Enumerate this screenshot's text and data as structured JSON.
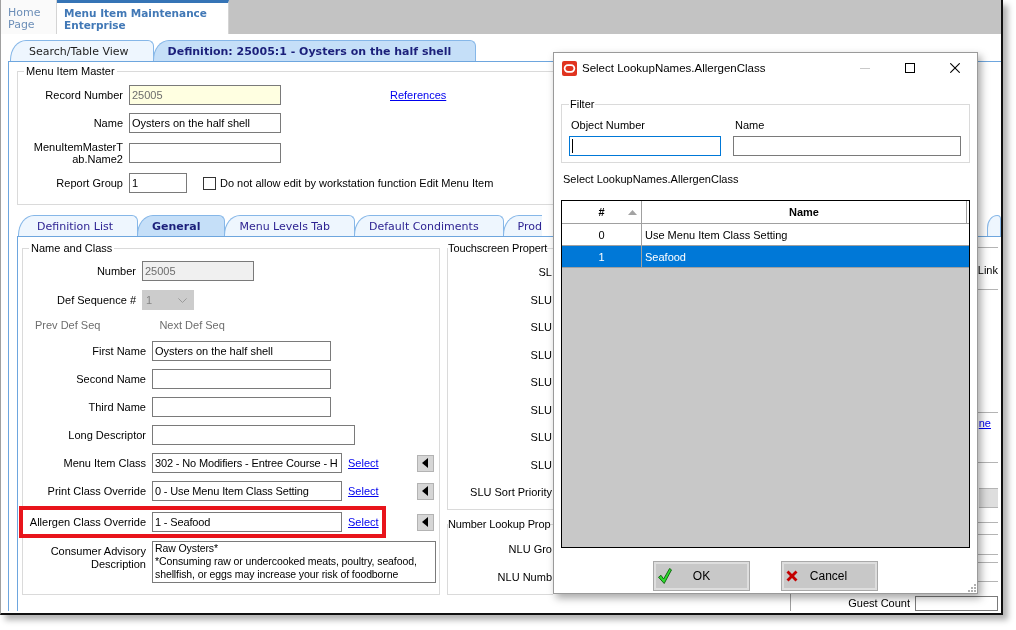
{
  "app_tabs": [
    {
      "label": "Home Page",
      "selected": false
    },
    {
      "label": "Menu Item Maintenance Enterprise",
      "selected": true
    }
  ],
  "record_tabs": [
    {
      "label": "Search/Table View",
      "selected": false
    },
    {
      "label": "Definition: 25005:1 - Oysters on the half shell",
      "selected": true
    }
  ],
  "menu_item_master": {
    "title": "Menu Item Master",
    "fields": [
      {
        "kind": "key",
        "label": "Record Number",
        "value": "25005",
        "link": "References"
      },
      {
        "kind": "text",
        "label": "Name",
        "value": "Oysters on the half shell"
      },
      {
        "kind": "text",
        "label": "MenuItemMasterTab.Name2"
      },
      {
        "kind": "short",
        "label": "Report Group",
        "value": "1",
        "checkbox": {
          "label": "Do not allow edit by workstation function Edit Menu Item",
          "checked": false
        }
      }
    ]
  },
  "detail_tabs": [
    {
      "label": "Definition List",
      "selected": false
    },
    {
      "label": "General",
      "selected": true
    },
    {
      "label": "Menu Levels Tab",
      "selected": false
    },
    {
      "label": "Default Condiments",
      "selected": false
    },
    {
      "label": "Prod",
      "selected": false
    },
    {
      "selected": false
    }
  ],
  "name_and_class": {
    "title": "Name and Class",
    "rows": [
      {
        "kind": "number",
        "label": "Number",
        "value": "25005",
        "disabled": true
      },
      {
        "kind": "combo",
        "label": "Def Sequence #",
        "value": "1",
        "disabled": true
      },
      {
        "kind": "nav",
        "buttons": [
          {
            "label": "Prev Def Seq",
            "disabled": true
          },
          {
            "label": "Next Def Seq",
            "disabled": true
          }
        ]
      },
      {
        "kind": "text",
        "label": "First Name",
        "value": "Oysters on the half shell"
      },
      {
        "kind": "text",
        "label": "Second Name"
      },
      {
        "kind": "text",
        "label": "Third Name"
      },
      {
        "kind": "wide",
        "label": "Long Descriptor"
      },
      {
        "kind": "select",
        "label": "Menu Item Class",
        "value": "302 - No Modifiers - Entree Course - H",
        "action": "Select",
        "highlighted": false
      },
      {
        "kind": "select",
        "label": "Print Class Override",
        "value": "0 - Use Menu Item Class Setting",
        "action": "Select",
        "highlighted": false
      },
      {
        "kind": "select",
        "label": "Allergen Class Override",
        "value": "1 - Seafood",
        "action": "Select",
        "highlighted": true
      },
      {
        "kind": "memo",
        "label": "Consumer Advisory Description",
        "value": "Raw Oysters*\n*Consuming raw or undercooked meats, poultry, seafood, shellfish, or eggs may increase your risk of foodborne"
      }
    ]
  },
  "touchscreen_properties": {
    "title": "Touchscreen Propert",
    "labels": [
      "SL",
      "SLU",
      "SLU",
      "SLU",
      "SLU",
      "SLU",
      "SLU",
      "SLU",
      "SLU Sort Priority"
    ]
  },
  "number_lookup_properties": {
    "title": "Number Lookup Prop",
    "labels": [
      "NLU Gro",
      "NLU Numb"
    ]
  },
  "side_panel": {
    "label": "Link",
    "link": "ne",
    "guest_count": {
      "label": "Guest Count"
    }
  },
  "dialog": {
    "title": "Select LookupNames.AllergenClass",
    "window_controls": [
      {
        "kind": "minimize",
        "disabled": true
      },
      {
        "kind": "maximize",
        "disabled": false
      },
      {
        "kind": "close",
        "disabled": false
      }
    ],
    "filter": {
      "title": "Filter",
      "fields": [
        {
          "label": "Object Number",
          "focused": true
        },
        {
          "label": "Name",
          "focused": false
        }
      ]
    },
    "list_label": "Select LookupNames.AllergenClass",
    "table": {
      "columns": [
        {
          "label": "#",
          "sorted": true
        },
        {
          "label": "Name",
          "sorted": false
        }
      ],
      "rows": [
        {
          "cells": [
            "0",
            "Use Menu Item Class Setting"
          ],
          "selected": false
        },
        {
          "cells": [
            "1",
            "Seafood"
          ],
          "selected": true
        }
      ]
    },
    "buttons": [
      {
        "kind": "ok",
        "label": "OK"
      },
      {
        "kind": "cancel",
        "label": "Cancel"
      }
    ]
  }
}
